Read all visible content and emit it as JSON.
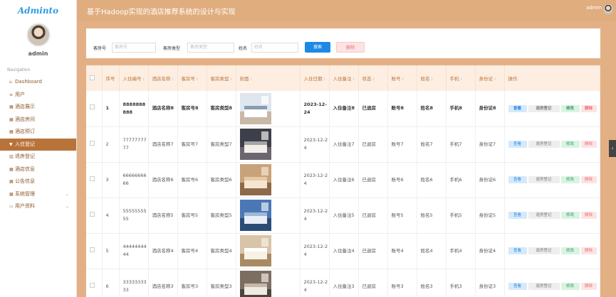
{
  "sidebar": {
    "brand": "Adminto",
    "user_name": "admin",
    "nav_title": "Navigation",
    "items": [
      {
        "icon": "home-icon",
        "glyph": "⌂",
        "label": "Dashboard"
      },
      {
        "icon": "list-icon",
        "glyph": "≡",
        "label": "用户"
      },
      {
        "icon": "hotel-icon",
        "glyph": "▦",
        "label": "酒店展示"
      },
      {
        "icon": "grid-icon",
        "glyph": "▦",
        "label": "酒店房间"
      },
      {
        "icon": "grid-icon",
        "glyph": "▦",
        "label": "酒店预订"
      },
      {
        "icon": "filter-icon",
        "glyph": "▼",
        "label": "入住登记",
        "active": true
      },
      {
        "icon": "chart-icon",
        "glyph": "▥",
        "label": "退房登记"
      },
      {
        "icon": "grid-icon",
        "glyph": "▦",
        "label": "酒店信息"
      },
      {
        "icon": "grid-icon",
        "glyph": "▦",
        "label": "公告信息"
      },
      {
        "icon": "grid-icon",
        "glyph": "▦",
        "label": "系统管理",
        "chevron": true
      },
      {
        "icon": "card-icon",
        "glyph": "▭",
        "label": "用户资料",
        "chevron": true
      }
    ]
  },
  "header": {
    "title": "基于Hadoop实现的酒店推荐系统的设计与实现",
    "user": "admin"
  },
  "search": {
    "room_no_label": "客房号",
    "room_no_placeholder": "客房号",
    "room_type_label": "客房类型",
    "room_type_placeholder": "客房类型",
    "name_label": "姓名",
    "name_placeholder": "姓名",
    "search_button": "搜索",
    "delete_button": "删除"
  },
  "table": {
    "headers": [
      "序号",
      "入住编号",
      "酒店名称",
      "客房号",
      "客房类型",
      "封面",
      "入住日期",
      "入住备注",
      "状态",
      "账号",
      "姓名",
      "手机",
      "身份证",
      "操作"
    ],
    "ops": {
      "view": "查看",
      "checkout": "退房登记",
      "edit": "修改",
      "delete": "删除"
    },
    "rows": [
      {
        "no": "1",
        "id": "8888888888",
        "hotel": "酒店名称8",
        "room": "客房号8",
        "type": "客房类型8",
        "date": "2023-12-24",
        "note": "入住备注8",
        "status": "已退房",
        "account": "账号8",
        "name": "姓名8",
        "phone": "手机8",
        "idcard": "身份证8"
      },
      {
        "no": "2",
        "id": "7777777777",
        "hotel": "酒店名称7",
        "room": "客房号7",
        "type": "客房类型7",
        "date": "2023-12-24",
        "note": "入住备注7",
        "status": "已退房",
        "account": "账号7",
        "name": "姓名7",
        "phone": "手机7",
        "idcard": "身份证7"
      },
      {
        "no": "3",
        "id": "6666666666",
        "hotel": "酒店名称6",
        "room": "客房号6",
        "type": "客房类型6",
        "date": "2023-12-24",
        "note": "入住备注6",
        "status": "已退房",
        "account": "账号6",
        "name": "姓名6",
        "phone": "手机6",
        "idcard": "身份证6"
      },
      {
        "no": "4",
        "id": "5555555555",
        "hotel": "酒店名称5",
        "room": "客房号5",
        "type": "客房类型5",
        "date": "2023-12-24",
        "note": "入住备注5",
        "status": "已退房",
        "account": "账号5",
        "name": "姓名5",
        "phone": "手机5",
        "idcard": "身份证5"
      },
      {
        "no": "5",
        "id": "4444444444",
        "hotel": "酒店名称4",
        "room": "客房号4",
        "type": "客房类型4",
        "date": "2023-12-24",
        "note": "入住备注4",
        "status": "已退房",
        "account": "账号4",
        "name": "姓名4",
        "phone": "手机4",
        "idcard": "身份证4"
      },
      {
        "no": "6",
        "id": "3333333333",
        "hotel": "酒店名称3",
        "room": "客房号3",
        "type": "客房类型3",
        "date": "2023-12-24",
        "note": "入住备注3",
        "status": "已退房",
        "account": "账号3",
        "name": "姓名3",
        "phone": "手机3",
        "idcard": "身份证3"
      }
    ]
  },
  "colors": {
    "accent": "#b8733a",
    "topbar": "#e0ad7e",
    "primary": "#1e88e5"
  }
}
